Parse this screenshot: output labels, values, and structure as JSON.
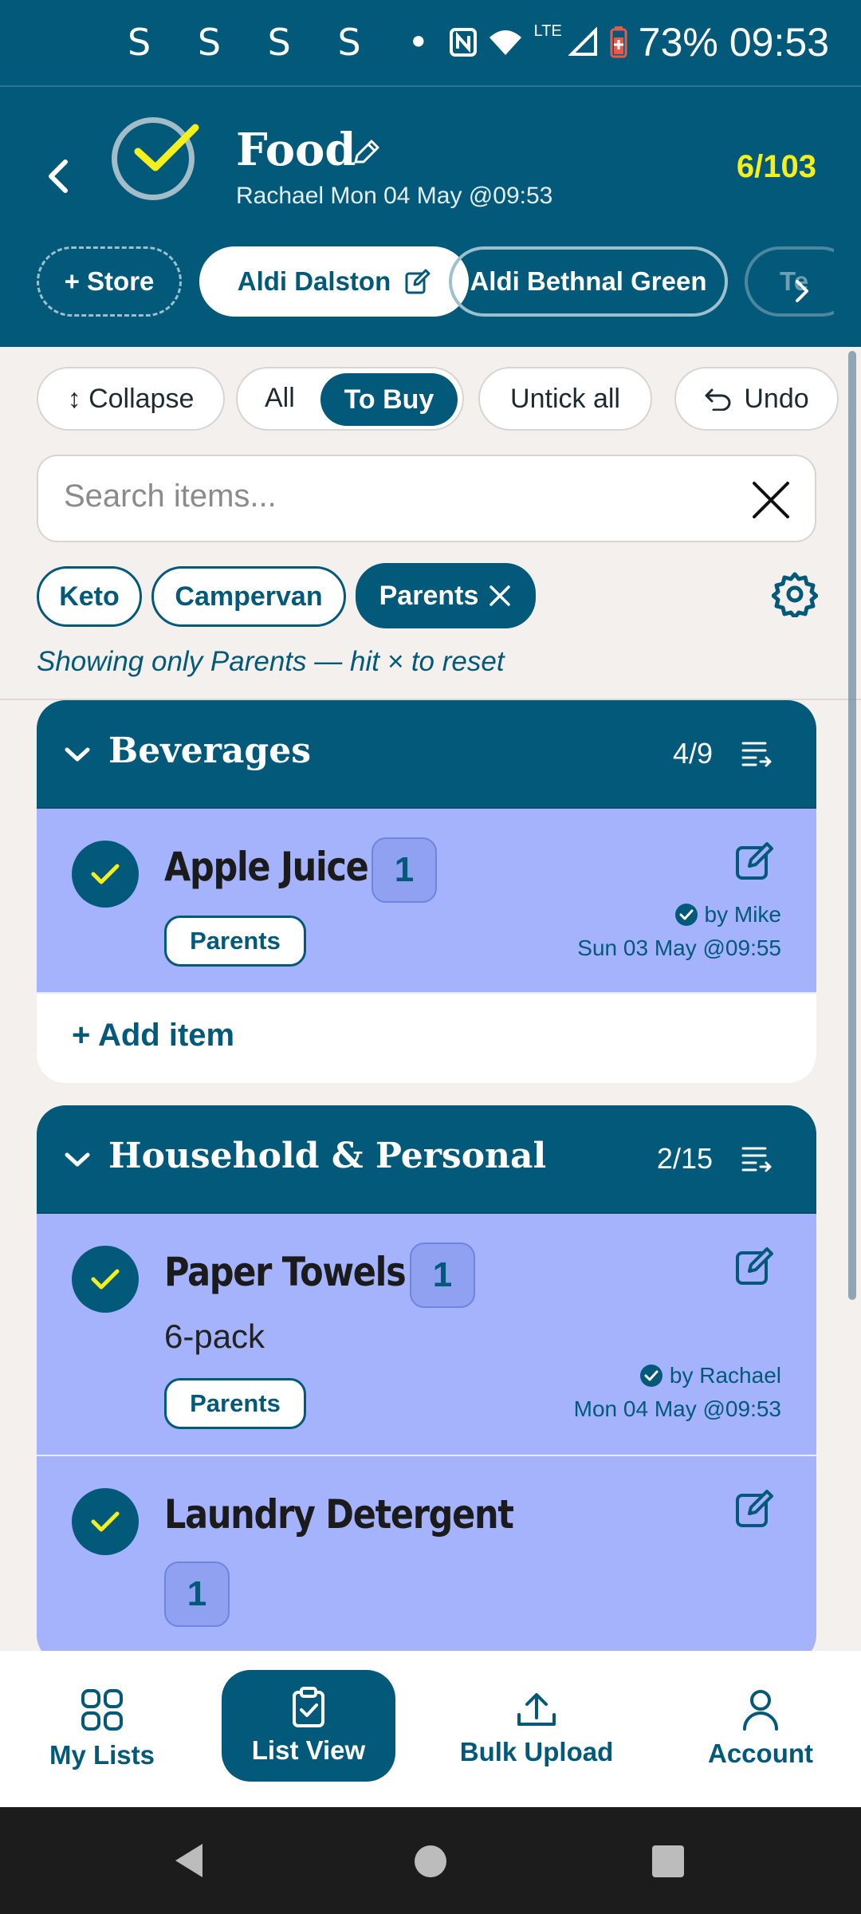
{
  "status_bar": {
    "notif_icons": "S S S S •",
    "network_label": "LTE",
    "battery": "73%",
    "time": "09:53"
  },
  "header": {
    "title": "Food",
    "subtitle": "Rachael Mon 04 May @09:53",
    "count": "6/103",
    "stores": [
      {
        "label": "+ Store"
      },
      {
        "label": "Aldi Dalston"
      },
      {
        "label": "Aldi Bethnal Green"
      },
      {
        "label": "Te"
      }
    ]
  },
  "toolbar": {
    "collapse": "↕ Collapse",
    "all": "All",
    "to_buy": "To Buy",
    "untick_all": "Untick all",
    "undo": "Undo"
  },
  "search": {
    "placeholder": "Search items..."
  },
  "tags": [
    {
      "label": "Keto"
    },
    {
      "label": "Campervan"
    },
    {
      "label": "Parents"
    }
  ],
  "filter_note": "Showing only Parents — hit × to reset",
  "sections": [
    {
      "title": "Beverages",
      "count": "4/9",
      "items": [
        {
          "name": "Apple Juice",
          "qty": "1",
          "tag": "Parents",
          "by": "by Mike",
          "date": "Sun 03 May @09:55"
        }
      ],
      "add_label": "+ Add item"
    },
    {
      "title": "Household & Personal",
      "count": "2/15",
      "items": [
        {
          "name": "Paper Towels",
          "qty": "1",
          "note": "6-pack",
          "tag": "Parents",
          "by": "by Rachael",
          "date": "Mon 04 May @09:53"
        },
        {
          "name": "Laundry Detergent",
          "qty": "1"
        }
      ]
    }
  ],
  "bottom_nav": [
    {
      "label": "My Lists"
    },
    {
      "label": "List View"
    },
    {
      "label": "Bulk Upload"
    },
    {
      "label": "Account"
    }
  ],
  "colors": {
    "primary": "#02597a",
    "accent_yellow": "#f5ef1c",
    "item_bg": "#a4b3fb",
    "page_bg": "#f3f0ed"
  }
}
